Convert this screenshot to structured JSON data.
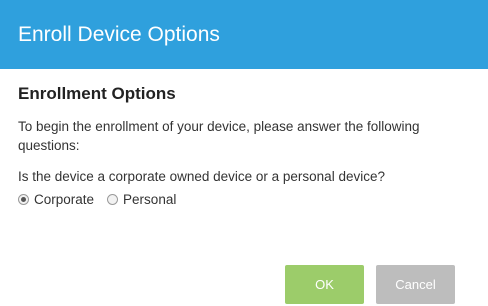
{
  "dialog": {
    "title": "Enroll Device Options"
  },
  "content": {
    "section_title": "Enrollment Options",
    "intro": "To begin the enrollment of your device, please answer the following questions:",
    "question": "Is the device a corporate owned device or a personal device?",
    "options": [
      {
        "label": "Corporate",
        "selected": true
      },
      {
        "label": "Personal",
        "selected": false
      }
    ]
  },
  "buttons": {
    "ok_label": "OK",
    "cancel_label": "Cancel"
  },
  "colors": {
    "title_bar": "#2fa0dd",
    "ok_button": "#9ccc6a",
    "cancel_button": "#bdbdbd"
  }
}
